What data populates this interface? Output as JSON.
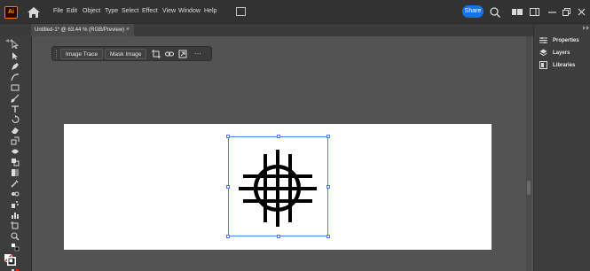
{
  "app": {
    "logo": "Ai"
  },
  "menu": {
    "items": [
      "File",
      "Edit",
      "Object",
      "Type",
      "Select",
      "Effect",
      "View",
      "Window",
      "Help"
    ]
  },
  "topbar": {
    "share_label": "Share"
  },
  "document": {
    "tab_label": "Untitled-1* @ 63.44 % (RGB/Preview)",
    "close_label": "×"
  },
  "context_bar": {
    "image_trace_label": "Image Trace",
    "mask_image_label": "Mask Image",
    "more_label": "···"
  },
  "panel": {
    "items": [
      {
        "label": "Properties",
        "icon": "properties-icon"
      },
      {
        "label": "Layers",
        "icon": "layers-icon"
      },
      {
        "label": "Libraries",
        "icon": "libraries-icon"
      }
    ]
  },
  "colors": {
    "accent": "#1473e6",
    "logo_orange": "#ff9a00",
    "selection": "#4b7bff"
  }
}
